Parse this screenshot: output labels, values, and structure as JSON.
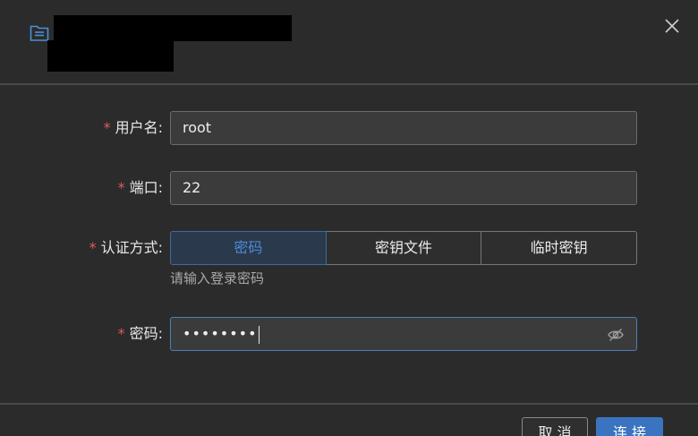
{
  "form": {
    "username": {
      "label": "用户名:",
      "value": "root"
    },
    "port": {
      "label": "端口:",
      "value": "22"
    },
    "auth": {
      "label": "认证方式:",
      "options": [
        "密码",
        "密钥文件",
        "临时密钥"
      ],
      "selected": "密码",
      "hint": "请输入登录密码"
    },
    "password": {
      "label": "密码:",
      "masked": "••••••••"
    },
    "required_mark": "*"
  },
  "footer": {
    "cancel_label": "取 消",
    "connect_label": "连 接"
  },
  "colors": {
    "accent": "#3a74c0",
    "required": "#e15a5a",
    "background": "#2b2b2b"
  }
}
